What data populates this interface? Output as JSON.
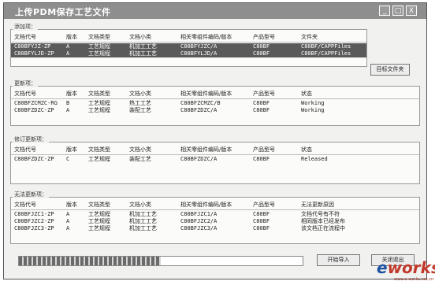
{
  "window": {
    "title": "上传PDM保存工艺文件",
    "controls": [
      "_",
      "□",
      "X"
    ]
  },
  "sections": [
    {
      "label": "添加项：",
      "headers": [
        "文档代号",
        "版本",
        "文档类型",
        "文档小类",
        "相关零组件编码/版本",
        "产品型号",
        "文件夹"
      ],
      "rows": [
        {
          "selected": true,
          "cells": [
            "C80BFYJZ-ZP",
            "A",
            "工艺规程",
            "机加工工艺",
            "C80BFYJZC/A",
            "C80BF",
            "C80BF/CAPPFiles"
          ]
        },
        {
          "selected": true,
          "cells": [
            "C80BFYLJD-ZP",
            "A",
            "工艺规程",
            "机加工工艺",
            "C80BFYLJD/A",
            "C80BF",
            "C80BF/CAPPFiles"
          ]
        }
      ]
    },
    {
      "label": "更新项：",
      "headers": [
        "文档代号",
        "版本",
        "文档类型",
        "文档小类",
        "相关零组件编码/版本",
        "产品型号",
        "状态"
      ],
      "rows": [
        {
          "selected": false,
          "cells": [
            "C80BFZCMZC-RG",
            "B",
            "工艺规程",
            "热工工艺",
            "C80BFZCMZC/B",
            "C80BF",
            "Working"
          ]
        },
        {
          "selected": false,
          "cells": [
            "C80BFZDZC-ZP",
            "A",
            "工艺规程",
            "装配工艺",
            "C80BFZDZC/A",
            "C80BF",
            "Working"
          ]
        }
      ]
    },
    {
      "label": "修订更新项：",
      "headers": [
        "文档代号",
        "版本",
        "文档类型",
        "文档小类",
        "相关零组件编码/版本",
        "产品型号",
        "状态"
      ],
      "rows": [
        {
          "selected": false,
          "cells": [
            "C80BFZDZC-ZP",
            "C",
            "工艺规程",
            "装配工艺",
            "C80BFZDZC/A",
            "C80BF",
            "Released"
          ]
        }
      ]
    },
    {
      "label": "无法更新项：",
      "headers": [
        "文档代号",
        "版本",
        "文档类型",
        "文档小类",
        "相关零组件编码/版本",
        "产品型号",
        "无法更新原因"
      ],
      "rows": [
        {
          "selected": false,
          "cells": [
            "C80BFJZC1-ZP",
            "A",
            "工艺规程",
            "机加工工艺",
            "C80BFJZC1/A",
            "C80BF",
            "文档代号有不符"
          ]
        },
        {
          "selected": false,
          "cells": [
            "C80BFJZC2-ZP",
            "A",
            "工艺规程",
            "机加工工艺",
            "C80BFJZC2/A",
            "C80BF",
            "相同版本已经发布"
          ]
        },
        {
          "selected": false,
          "cells": [
            "C80BFJZC3-ZP",
            "A",
            "工艺规程",
            "机加工工艺",
            "C80BFJZC3/A",
            "C80BF",
            "该文档正在流程中"
          ]
        }
      ]
    }
  ],
  "buttons": {
    "target_folder": "目标文件夹",
    "start_import": "开始导入",
    "exit": "关闭退出"
  },
  "progress": {
    "value": 0.5
  },
  "watermark": {
    "word": "eworks",
    "sub": "www.e-works.net.cn"
  },
  "colors": {
    "title_bg": "#8e8e8e",
    "selection_bg": "#5a5a5a",
    "watermark_e": "#1b4fa0",
    "watermark_rest": "#c0392b"
  }
}
